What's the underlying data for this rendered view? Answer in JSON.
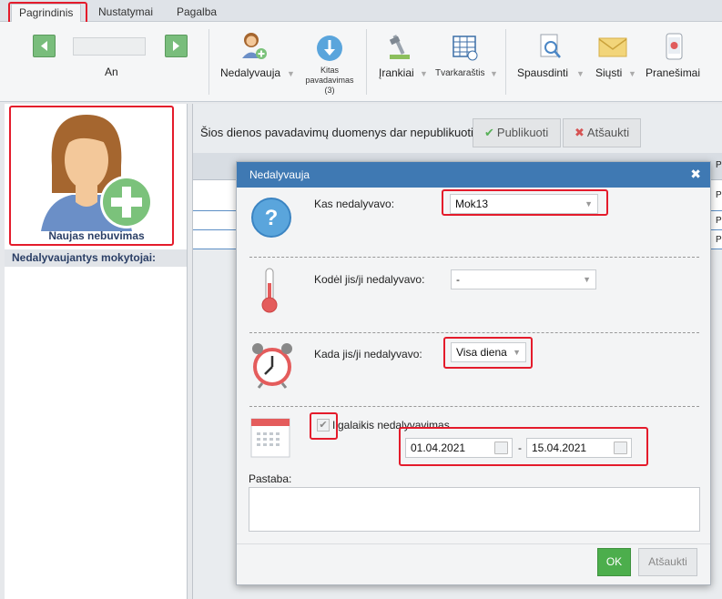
{
  "menubar": {
    "tabs": [
      {
        "label": "Pagrindinis"
      },
      {
        "label": "Nustatymai"
      },
      {
        "label": "Pagalba"
      }
    ]
  },
  "ribbon": {
    "day_label": "An",
    "nedalyvauja": "Nedalyvauja",
    "kitas_pavadavimas": "Kitas pavadavimas (3)",
    "irankiai": "Įrankiai",
    "tvarkarastis": "Tvarkaraštis",
    "spausdinti": "Spausdinti",
    "siusti": "Siųsti",
    "pranesimai": "Pranešimai"
  },
  "left": {
    "new_absence_label": "Naujas nebuvimas",
    "section_header": "Nedalyvaujantys mokytojai:"
  },
  "right": {
    "notice": "Šios dienos pavadavimų duomenys dar nepublikuoti.",
    "publish_btn": "Publikuoti",
    "cancel_btn": "Atšaukti",
    "row_marker": "Pa"
  },
  "dialog": {
    "title": "Nedalyvauja",
    "who_label": "Kas nedalyvavo:",
    "who_value": "Mok13",
    "why_label": "Kodėl jis/ji nedalyvavo:",
    "why_value": "-",
    "when_label": "Kada jis/ji nedalyvavo:",
    "when_value": "Visa diena",
    "longterm_label": "Ilgalaikis nedalyvavimas",
    "date_from": "01.04.2021",
    "date_sep": "-",
    "date_to": "15.04.2021",
    "note_label": "Pastaba:",
    "note_value": "",
    "ok_btn": "OK",
    "cancel_btn": "Atšaukti"
  },
  "colors": {
    "accent": "#3f79b3",
    "highlight": "#e41b2b",
    "ok": "#4cae4c"
  }
}
